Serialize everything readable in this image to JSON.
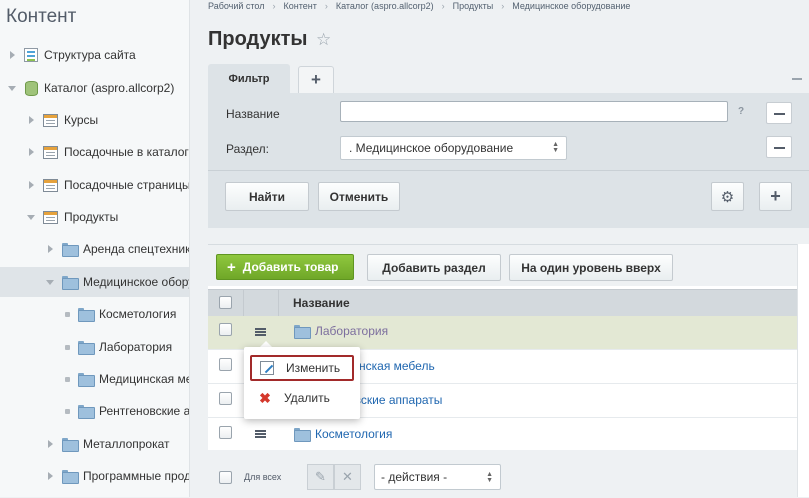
{
  "sidebar": {
    "title": "Контент",
    "items": [
      {
        "label": "Структура сайта"
      },
      {
        "label": "Каталог (aspro.allcorp2)"
      },
      {
        "label": "Курсы"
      },
      {
        "label": "Посадочные в каталоге"
      },
      {
        "label": "Посадочные страницы"
      },
      {
        "label": "Продукты"
      },
      {
        "label": "Аренда спецтехники"
      },
      {
        "label": "Медицинское оборудование"
      },
      {
        "label": "Косметология"
      },
      {
        "label": "Лаборатория"
      },
      {
        "label": "Медицинская мебель"
      },
      {
        "label": "Рентгеновские аппараты"
      },
      {
        "label": "Металлопрокат"
      },
      {
        "label": "Программные продукты"
      }
    ]
  },
  "breadcrumb": [
    "Рабочий стол",
    "Контент",
    "Каталог (aspro.allcorp2)",
    "Продукты",
    "Медицинское оборудование"
  ],
  "page": {
    "title": "Продукты"
  },
  "filter": {
    "tab_label": "Фильтр",
    "add_tab": "+",
    "name_label": "Название",
    "name_value": "",
    "help_mark": "?",
    "section_label": "Раздел:",
    "section_value": ". Медицинское оборудование",
    "find_button": "Найти",
    "cancel_button": "Отменить",
    "add_button": "+"
  },
  "toolbar": {
    "add_product": "Добавить товар",
    "add_section": "Добавить раздел",
    "level_up": "На один уровень вверх"
  },
  "grid": {
    "column_name": "Название",
    "rows": [
      {
        "name": "Лаборатория"
      },
      {
        "name": "нская мебель"
      },
      {
        "name": "овские аппараты"
      },
      {
        "name": "Косметология"
      }
    ],
    "footer": {
      "for_all": "Для всех",
      "actions_select": "- действия -"
    }
  },
  "context_menu": {
    "edit": "Изменить",
    "delete": "Удалить"
  }
}
